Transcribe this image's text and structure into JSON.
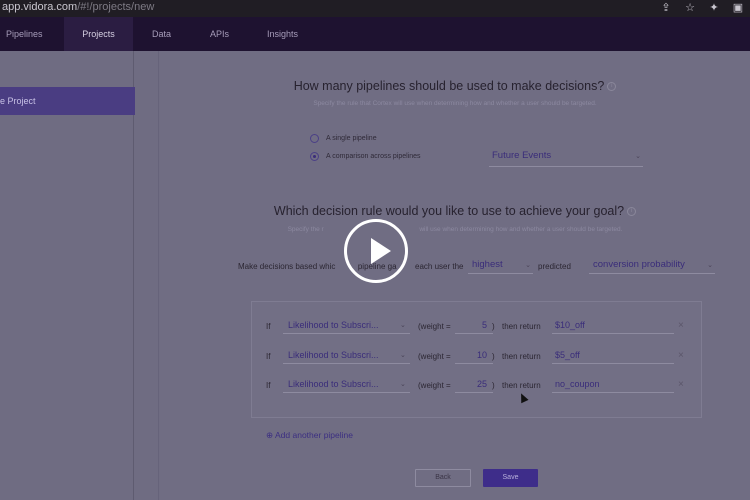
{
  "browser": {
    "url_host": "app.vidora.com",
    "url_path": "/#!/projects/new",
    "icons": [
      "share-icon",
      "star-icon",
      "extensions-icon",
      "sidebar-icon"
    ]
  },
  "nav": {
    "tabs": [
      {
        "label": "Pipelines"
      },
      {
        "label": "Projects",
        "active": true
      },
      {
        "label": "Data"
      },
      {
        "label": "APIs"
      },
      {
        "label": "Insights"
      }
    ]
  },
  "sidebar": {
    "active_item": "e Project"
  },
  "q1": {
    "title": "How many pipelines should be used to make decisions?",
    "subtitle": "Specify the rule that Cortex will use when determining how and whether a user should be targeted.",
    "options": [
      {
        "label": "A single pipeline",
        "checked": false
      },
      {
        "label": "A comparison across pipelines",
        "checked": true
      }
    ],
    "source_select": "Future Events"
  },
  "q2": {
    "title": "Which decision rule would you like to use to achieve your goal?",
    "subtitle_left": "Specify the r",
    "subtitle_right": "will use when determining how and whether a user should be targeted.",
    "rule_prefix": "Make decisions based whic",
    "rule_mid": "pipeline ga",
    "rule_mid2": "each user the",
    "extreme_select": "highest",
    "predicted_label": "predicted",
    "metric_select": "conversion probability"
  },
  "rules": [
    {
      "if": "If",
      "pipeline": "Likelihood to Subscri...",
      "weight_label": "(weight =",
      "weight": "5",
      "close_paren": ")",
      "then": "then return",
      "value": "$10_off"
    },
    {
      "if": "If",
      "pipeline": "Likelihood to Subscri...",
      "weight_label": "(weight =",
      "weight": "10",
      "close_paren": ")",
      "then": "then return",
      "value": "$5_off"
    },
    {
      "if": "If",
      "pipeline": "Likelihood to Subscri...",
      "weight_label": "(weight =",
      "weight": "25",
      "close_paren": ")",
      "then": "then return",
      "value": "no_coupon"
    }
  ],
  "add_pipeline": "⊕ Add another pipeline",
  "buttons": {
    "back": "Back",
    "save": "Save"
  },
  "colors": {
    "accent": "#3e2d8a",
    "nav_bg": "#1e1230",
    "overlay": "#706d83"
  }
}
